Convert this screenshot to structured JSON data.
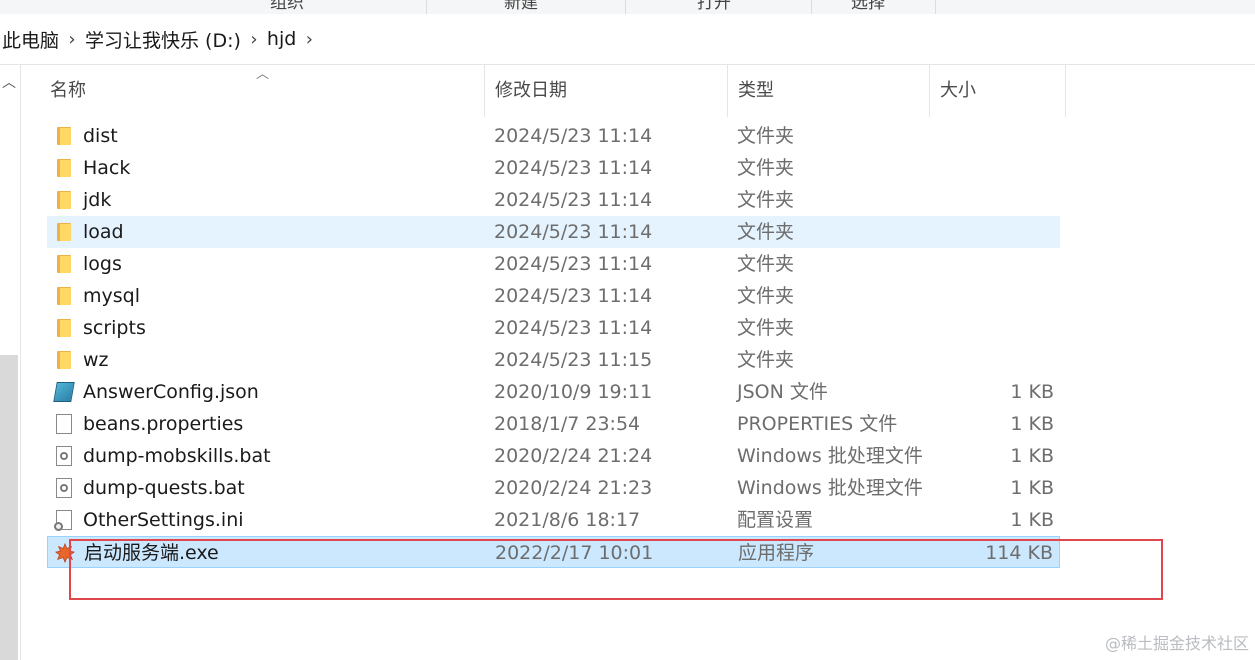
{
  "ribbon": {
    "labels": [
      "组织",
      "新建",
      "打开",
      "选择"
    ]
  },
  "address": {
    "crumbs": [
      "此电脑",
      "学习让我快乐 (D:)",
      "hjd"
    ]
  },
  "columns": {
    "name": "名称",
    "date": "修改日期",
    "type": "类型",
    "size": "大小"
  },
  "files": [
    {
      "name": "dist",
      "date": "2024/5/23 11:14",
      "type": "文件夹",
      "size": "",
      "icon": "folder-icon"
    },
    {
      "name": "Hack",
      "date": "2024/5/23 11:14",
      "type": "文件夹",
      "size": "",
      "icon": "folder-icon"
    },
    {
      "name": "jdk",
      "date": "2024/5/23 11:14",
      "type": "文件夹",
      "size": "",
      "icon": "folder-icon"
    },
    {
      "name": "load",
      "date": "2024/5/23 11:14",
      "type": "文件夹",
      "size": "",
      "icon": "folder-icon",
      "state": "hover"
    },
    {
      "name": "logs",
      "date": "2024/5/23 11:14",
      "type": "文件夹",
      "size": "",
      "icon": "folder-icon"
    },
    {
      "name": "mysql",
      "date": "2024/5/23 11:14",
      "type": "文件夹",
      "size": "",
      "icon": "folder-icon"
    },
    {
      "name": "scripts",
      "date": "2024/5/23 11:14",
      "type": "文件夹",
      "size": "",
      "icon": "folder-icon"
    },
    {
      "name": "wz",
      "date": "2024/5/23 11:15",
      "type": "文件夹",
      "size": "",
      "icon": "folder-icon"
    },
    {
      "name": "AnswerConfig.json",
      "date": "2020/10/9 19:11",
      "type": "JSON 文件",
      "size": "1 KB",
      "icon": "json-file-icon"
    },
    {
      "name": "beans.properties",
      "date": "2018/1/7 23:54",
      "type": "PROPERTIES 文件",
      "size": "1 KB",
      "icon": "document-icon"
    },
    {
      "name": "dump-mobskills.bat",
      "date": "2020/2/24 21:24",
      "type": "Windows 批处理文件",
      "size": "1 KB",
      "icon": "batch-file-icon"
    },
    {
      "name": "dump-quests.bat",
      "date": "2020/2/24 21:23",
      "type": "Windows 批处理文件",
      "size": "1 KB",
      "icon": "batch-file-icon"
    },
    {
      "name": "OtherSettings.ini",
      "date": "2021/8/6 18:17",
      "type": "配置设置",
      "size": "1 KB",
      "icon": "settings-file-icon"
    },
    {
      "name": "启动服务端.exe",
      "date": "2022/2/17 10:01",
      "type": "应用程序",
      "size": "114 KB",
      "icon": "maple-leaf-app-icon",
      "state": "selected"
    }
  ],
  "watermark": "@稀土掘金技术社区",
  "colors": {
    "hover": "#e5f3ff",
    "selected": "#cce8ff",
    "annotation": "#e0474c",
    "folder": "#ffd866"
  }
}
